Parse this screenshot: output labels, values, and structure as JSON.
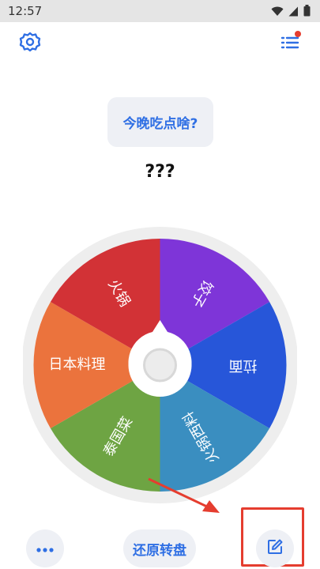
{
  "status_bar": {
    "time": "12:57",
    "icons": [
      "wifi-icon",
      "cell-signal-icon",
      "battery-icon"
    ]
  },
  "header": {
    "settings_icon": "gear-icon",
    "menu_icon": "list-icon",
    "menu_badge_color": "#e53d2f"
  },
  "question": "今晚吃点啥?",
  "result_text": "???",
  "wheel": {
    "segments": [
      {
        "label": "饺子",
        "color": "#7e35d8"
      },
      {
        "label": "拉面",
        "color": "#2756d9"
      },
      {
        "label": "火锅西料",
        "color": "#3a8ec0"
      },
      {
        "label": "泰国菜",
        "color": "#6ea443"
      },
      {
        "label": "日本料理",
        "color": "#eb733d"
      },
      {
        "label": "火锅",
        "color": "#d23236"
      }
    ],
    "rim_color": "#eeeeee"
  },
  "footer": {
    "more_icon": "more-dots-icon",
    "reset_label": "还原转盘",
    "edit_icon": "edit-icon"
  },
  "colors": {
    "accent": "#2f6fe4",
    "annotation_red": "#e53d2f"
  }
}
